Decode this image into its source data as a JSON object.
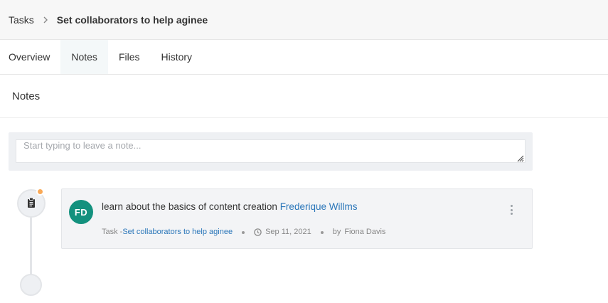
{
  "breadcrumb": {
    "root": "Tasks",
    "current": "Set collaborators to help aginee"
  },
  "tabs": [
    {
      "label": "Overview",
      "active": false
    },
    {
      "label": "Notes",
      "active": true
    },
    {
      "label": "Files",
      "active": false
    },
    {
      "label": "History",
      "active": false
    }
  ],
  "section": {
    "title": "Notes"
  },
  "composer": {
    "placeholder": "Start typing to leave a note..."
  },
  "note": {
    "avatar_initials": "FD",
    "avatar_color": "#13917e",
    "text": "learn about the basics of content creation",
    "mention": "Frederique Willms",
    "meta_prefix": "Task - ",
    "task_link": "Set collaborators to help aginee",
    "date": "Sep 11, 2021",
    "by_label": "by",
    "author": "Fiona Davis"
  },
  "colors": {
    "accent_link": "#2a76b9",
    "timeline_dot": "#f9a957"
  }
}
